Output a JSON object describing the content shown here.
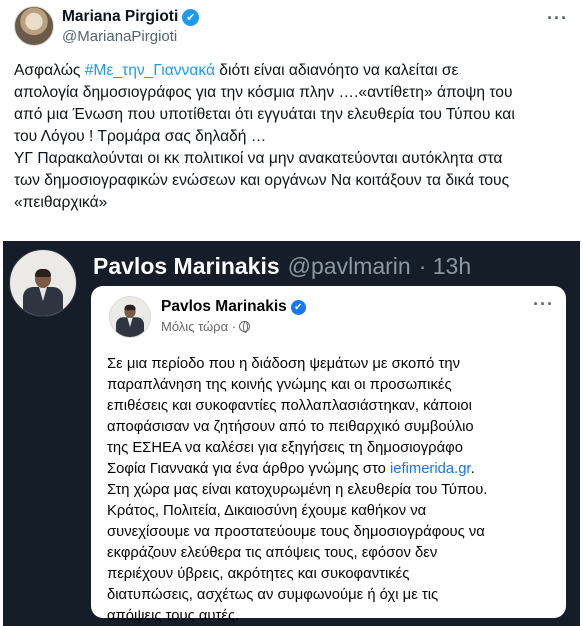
{
  "author": {
    "display_name": "Mariana Pirgioti",
    "handle": "@MarianaPirgioti",
    "verified_mark": "✔",
    "more_label": "···"
  },
  "tweet": {
    "lines": [
      [
        "Ασφαλώς ",
        "#Με_την_Γιαννακά",
        "  διότι είναι αδιανόητο να καλείται σε"
      ],
      [
        "απολογία δημοσιογράφος για την κόσμια  πλην ….«αντίθετη» άποψη του"
      ],
      [
        "από μια Ένωση  που υποτίθεται ότι εγγυάται την ελευθερία του Τύπου και"
      ],
      [
        "του Λόγου ! Τρομάρα σας δηλαδή …"
      ],
      [
        "ΥΓ Παρακαλούνται οι κκ πολιτικοί να μην ανακατεύονται αυτόκλητα στα"
      ],
      [
        "των δημοσιογραφικών ενώσεων και οργάνων Να κοιτάξουν τα δικά τους"
      ],
      [
        "«πειθαρχικά»"
      ]
    ]
  },
  "embedded_tweet": {
    "display_name": "Pavlos Marinakis",
    "handle": "@pavlmarin",
    "time": "· 13h"
  },
  "facebook_post": {
    "author": "Pavlos Marinakis",
    "verified_mark": "✔",
    "meta": "Μόλις τώρα ·",
    "more_label": "···",
    "lines": [
      [
        "Σε μια περίοδο που η διάδοση ψεμάτων με σκοπό την"
      ],
      [
        "παραπλάνηση της κοινής γνώμης και οι προσωπικές"
      ],
      [
        "επιθέσεις και συκοφαντίες πολλαπλασιάστηκαν, κάποιοι"
      ],
      [
        "αποφάσισαν να ζητήσουν από το πειθαρχικό συμβούλιο"
      ],
      [
        "της ΕΣΗΕΑ να καλέσει για εξηγήσεις τη δημοσιογράφο"
      ],
      [
        "Σοφία Γιαννακά για ένα άρθρο γνώμης στο ",
        "iefimerida.gr",
        "."
      ],
      [
        "Στη χώρα μας είναι κατοχυρωμένη η ελευθερία του Τύπου."
      ],
      [
        "Κράτος, Πολιτεία, Δικαιοσύνη έχουμε καθήκον να"
      ],
      [
        "συνεχίσουμε να προστατεύουμε τους δημοσιογράφους να"
      ],
      [
        "εκφράζουν ελεύθερα τις απόψεις τους, εφόσον δεν"
      ],
      [
        "περιέχουν ύβρεις, ακρότητες και συκοφαντικές"
      ],
      [
        "διατυπώσεις, ασχέτως αν συμφωνούμε ή όχι με τις"
      ],
      [
        "απόψεις τους αυτές."
      ]
    ]
  },
  "colors": {
    "link_blue": "#1d9bf0",
    "facebook_blue": "#1877f2",
    "dark_background": "#151d28"
  }
}
